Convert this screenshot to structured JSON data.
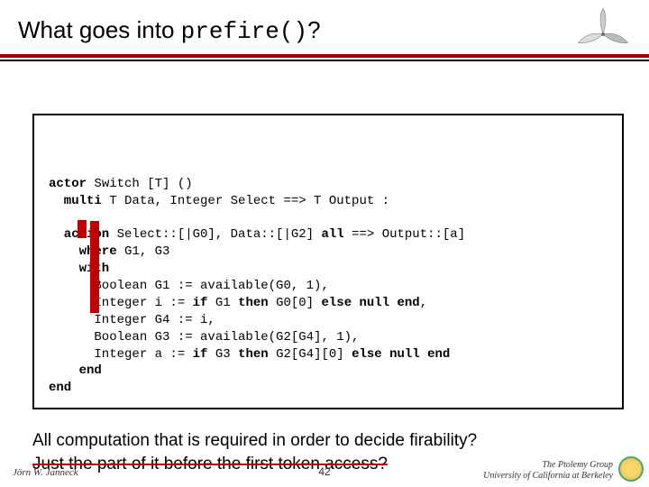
{
  "header": {
    "title_prefix": "What goes into ",
    "title_code": "prefire()",
    "title_suffix": "?"
  },
  "code": {
    "l1a": "actor",
    "l1b": " Switch [T] ()",
    "l2a": "  multi",
    "l2b": " T Data, Integer Select ==> T Output :",
    "blank1": "",
    "l3a": "  action",
    "l3b": " Select::[|G0], Data::[|G2] ",
    "l3c": "all",
    "l3d": " ==> Output::[a]",
    "l4a": "    where",
    "l4b": " G1, G3",
    "l5a": "    with",
    "l6": "      Boolean G1 := available(G0, 1),",
    "l7a": "      Integer i := ",
    "l7b": "if",
    "l7c": " G1 ",
    "l7d": "then",
    "l7e": " G0[0] ",
    "l7f": "else null end",
    "l7g": ",",
    "l8": "      Integer G4 := i,",
    "l9": "      Boolean G3 := available(G2[G4], 1),",
    "l10a": "      Integer a := ",
    "l10b": "if",
    "l10c": " G3 ",
    "l10d": "then",
    "l10e": " G2[G4][0] ",
    "l10f": "else null end",
    "l11": "    end",
    "l12": "end"
  },
  "caption": {
    "line1": "All computation that is required in order to decide firability?",
    "line2": "Just the part of it before the first token access?"
  },
  "footer": {
    "left": "Jörn W. Janneck",
    "center": "42",
    "right1": "The Ptolemy Group",
    "right2": "University of California at Berkeley"
  }
}
